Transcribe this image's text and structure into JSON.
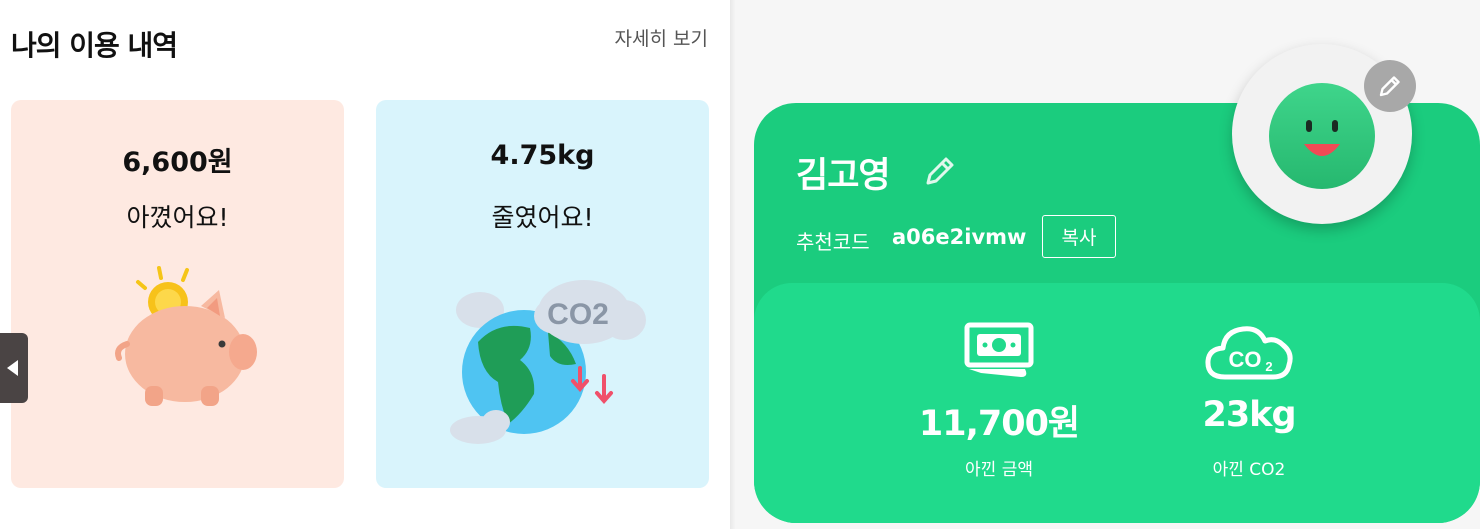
{
  "history": {
    "title": "나의 이용 내역",
    "detail_link": "자세히 보기",
    "savings_card": {
      "amount": "6,600원",
      "desc": "아꼈어요!",
      "icon": "piggy-bank-icon"
    },
    "carbon_card": {
      "amount": "4.75kg",
      "desc": "줄였어요!",
      "icon": "earth-co2-icon",
      "co2_text": "CO2"
    }
  },
  "profile": {
    "name": "김고영",
    "referral_label": "추천코드",
    "referral_code": "a06e2ivmw",
    "copy_label": "복사",
    "stats": [
      {
        "value": "11,700원",
        "label": "아낀 금액",
        "icon": "money-icon"
      },
      {
        "value": "23kg",
        "label": "아낀 CO2",
        "icon": "co2-cloud-icon"
      }
    ]
  },
  "colors": {
    "savings_bg": "#fee9e1",
    "carbon_bg": "#d9f4fc",
    "profile_green": "#1bcc7e",
    "stats_green": "#20da8c"
  }
}
